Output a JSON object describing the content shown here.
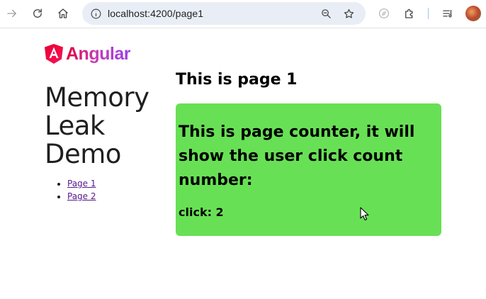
{
  "browser": {
    "url": "localhost:4200/page1",
    "icons": [
      "arrow-forward-icon",
      "reload-icon",
      "home-icon",
      "site-info-icon",
      "zoom-icon",
      "bookmark-star-icon",
      "extension-compass-icon",
      "extensions-puzzle-icon",
      "reading-list-icon",
      "profile-avatar"
    ]
  },
  "sidebar": {
    "logo_text": "Angular",
    "app_title": "Memory Leak Demo",
    "links": [
      {
        "label": "Page 1"
      },
      {
        "label": "Page 2"
      }
    ]
  },
  "main": {
    "heading": "This is page 1",
    "counter": {
      "description": "This is page counter, it will show the user click count number:",
      "click_label": "click: 2"
    }
  },
  "colors": {
    "card_background": "#68e055",
    "link": "#551a8b",
    "angular_red": "#e40035",
    "angular_purple": "#9b3fe8"
  }
}
